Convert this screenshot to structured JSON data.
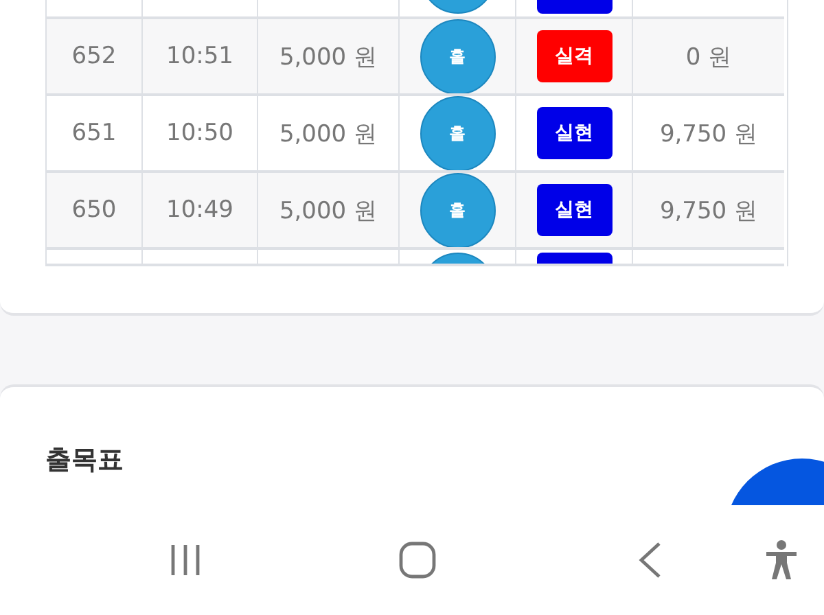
{
  "table": {
    "row_above": {
      "color": "#0000e8"
    },
    "rows": [
      {
        "round": "652",
        "time": "10:51",
        "bet": "5,000 원",
        "pick": "홀",
        "result": "실격",
        "color": "#ff0000",
        "payout": "0 원"
      },
      {
        "round": "651",
        "time": "10:50",
        "bet": "5,000 원",
        "pick": "홀",
        "result": "실현",
        "color": "#0000e8",
        "payout": "9,750 원"
      },
      {
        "round": "650",
        "time": "10:49",
        "bet": "5,000 원",
        "pick": "홀",
        "result": "실현",
        "color": "#0000e8",
        "payout": "9,750 원"
      }
    ],
    "row_below": {
      "color": "#0000e8"
    }
  },
  "schedule_card": {
    "title": "출목표"
  }
}
